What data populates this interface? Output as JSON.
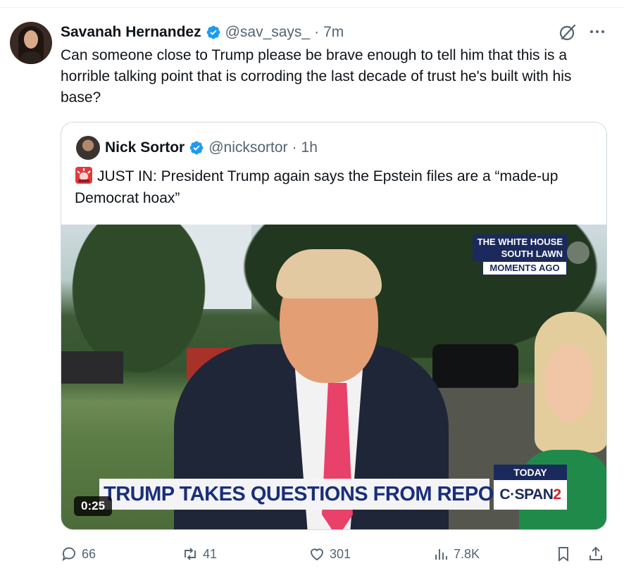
{
  "tweet": {
    "author_name": "Savanah Hernandez",
    "handle": "@sav_says_",
    "separator": "·",
    "time": "7m",
    "text": "Can someone close to Trump please be brave enough to tell him that this is a horrible talking point that is corroding the last decade of trust he's built with his base?"
  },
  "quote": {
    "author_name": "Nick Sortor",
    "handle": "@nicksortor",
    "separator": "·",
    "time": "1h",
    "text": "JUST IN: President Trump again says the Epstein files are a “made-up Democrat hoax”"
  },
  "video": {
    "location_line1": "THE WHITE HOUSE",
    "location_line2": "SOUTH LAWN",
    "timing": "MOMENTS AGO",
    "headline": "TRUMP TAKES QUESTIONS FROM REPORTERS",
    "today_label": "TODAY",
    "network_main": "C·SPAN",
    "network_suffix": "2",
    "duration": "0:25"
  },
  "actions": {
    "replies": "66",
    "reposts": "41",
    "likes": "301",
    "views": "7.8K"
  },
  "colors": {
    "verified_blue": "#1d9bf0",
    "muted_text": "#536471",
    "cspan_navy": "#1b2a5c",
    "cspan_red": "#d6232a"
  },
  "icons": [
    "verified-badge-icon",
    "grok-icon",
    "more-icon",
    "siren-icon",
    "reply-icon",
    "repost-icon",
    "like-icon",
    "views-icon",
    "bookmark-icon",
    "share-icon"
  ]
}
